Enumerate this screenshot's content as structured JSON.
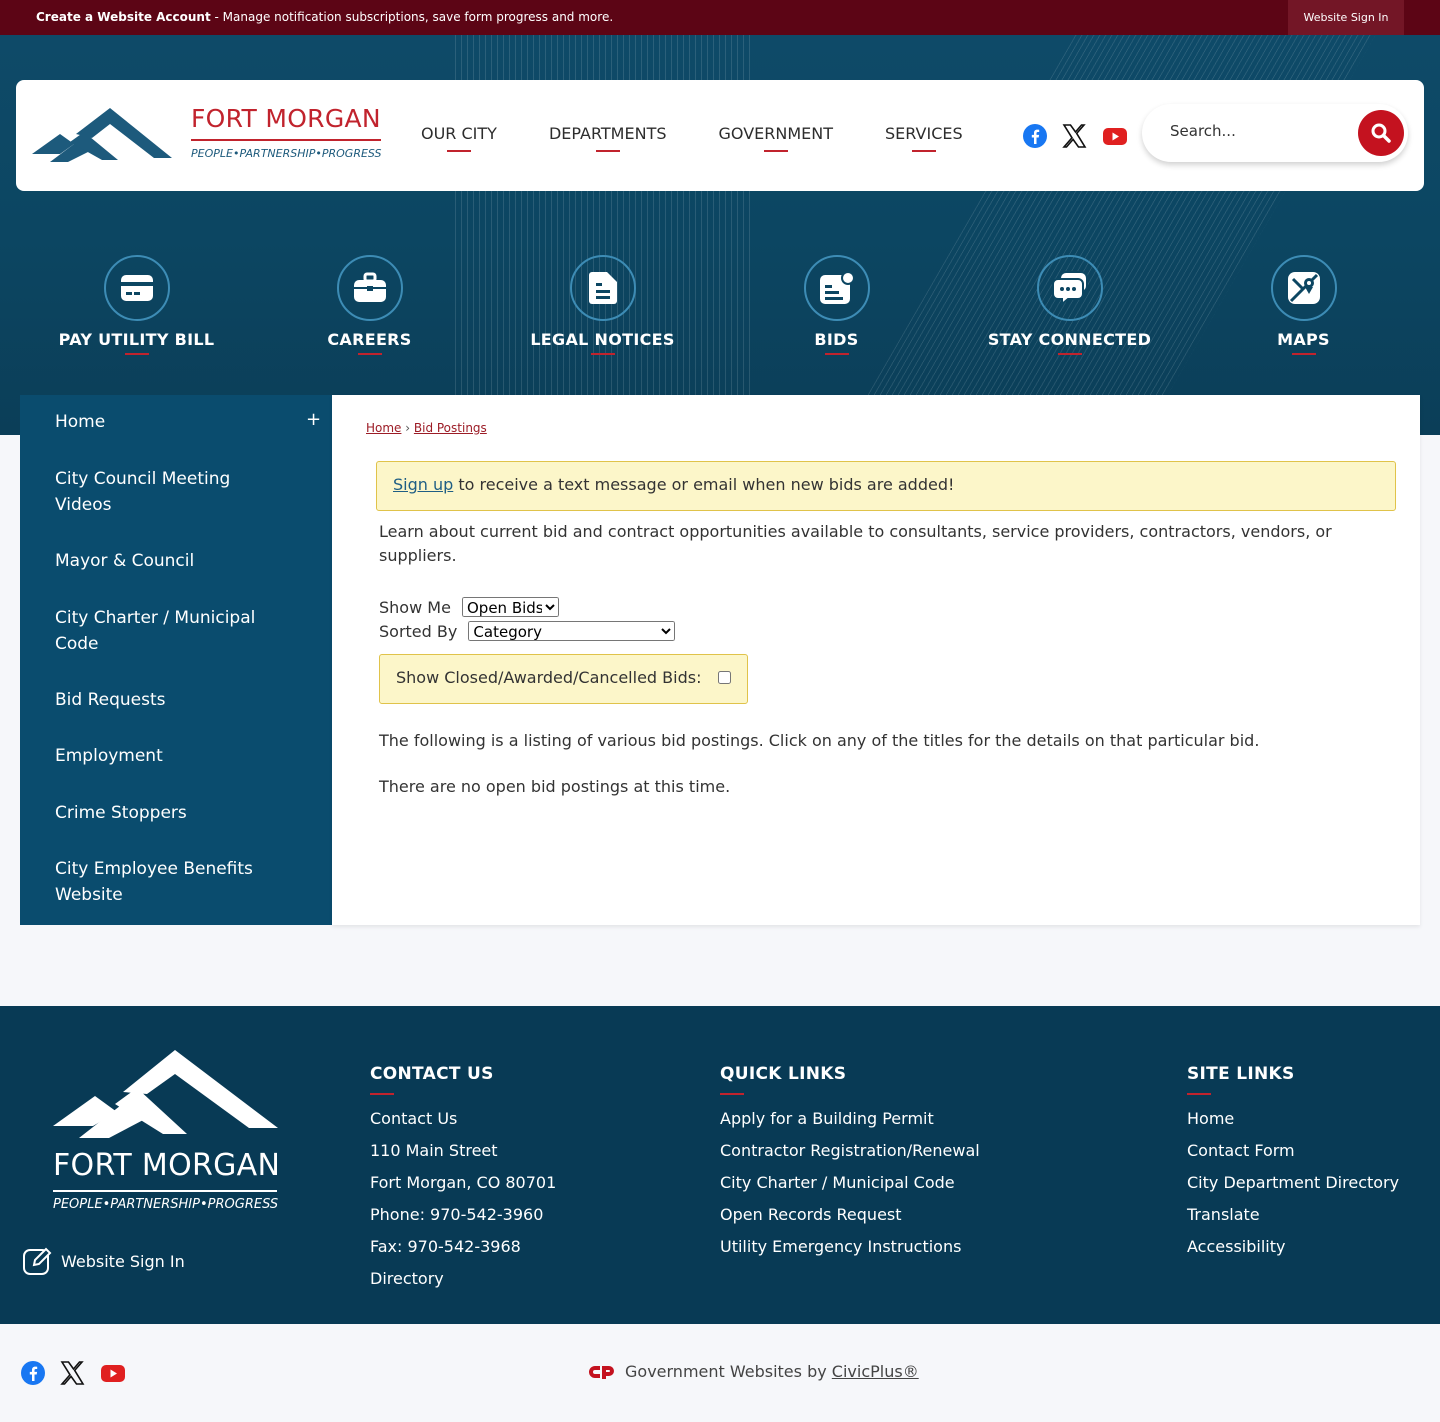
{
  "topbar": {
    "create_account": "Create a Website Account",
    "message": " - Manage notification subscriptions, save form progress and more.",
    "signin": "Website Sign In"
  },
  "brand": {
    "title": "FORT MORGAN",
    "tagline": "PEOPLE•PARTNERSHIP•PROGRESS"
  },
  "nav": [
    "OUR CITY",
    "DEPARTMENTS",
    "GOVERNMENT",
    "SERVICES"
  ],
  "search": {
    "placeholder": "Search..."
  },
  "quick_links": [
    {
      "label": "PAY UTILITY BILL",
      "icon": "credit-card-icon"
    },
    {
      "label": "CAREERS",
      "icon": "briefcase-icon"
    },
    {
      "label": "LEGAL NOTICES",
      "icon": "document-icon"
    },
    {
      "label": "BIDS",
      "icon": "bids-document-icon"
    },
    {
      "label": "STAY CONNECTED",
      "icon": "chat-bubbles-icon"
    },
    {
      "label": "MAPS",
      "icon": "map-icon"
    }
  ],
  "sidebar": {
    "items": [
      "Home",
      "City Council Meeting Videos",
      "Mayor & Council",
      "City Charter / Municipal Code",
      "Bid Requests",
      "Employment",
      "Crime Stoppers",
      "City Employee Benefits Website"
    ],
    "expand": "+"
  },
  "content": {
    "breadcrumb": {
      "home": "Home",
      "sep": " › ",
      "current": "Bid Postings"
    },
    "alert": {
      "link": "Sign up",
      "text": " to receive a text message or email when new bids are added!"
    },
    "intro": "Learn about current bid and contract opportunities available to consultants, service providers, contractors, vendors, or suppliers.",
    "show_me_label": "Show Me",
    "show_me_value": "Open Bids",
    "sorted_by_label": "Sorted By",
    "sorted_by_value": "Category",
    "closed_label": "Show Closed/Awarded/Cancelled Bids:",
    "listing_text": "The following is a listing of various bid postings. Click on any of the titles for the details on that particular bid.",
    "empty_text": "There are no open bid postings at this time."
  },
  "footer": {
    "logo_title": "FORT MORGAN",
    "logo_tagline": "PEOPLE•PARTNERSHIP•PROGRESS",
    "signin": "Website Sign In",
    "contact": {
      "title": "CONTACT US",
      "lines": [
        "Contact Us",
        "110 Main Street",
        "Fort Morgan, CO 80701",
        "Phone: 970-542-3960",
        "Fax: 970-542-3968",
        "Directory"
      ]
    },
    "quick": {
      "title": "QUICK LINKS",
      "lines": [
        "Apply for a Building Permit",
        "Contractor Registration/Renewal",
        "City Charter / Municipal Code",
        "Open Records Request",
        "Utility Emergency Instructions"
      ]
    },
    "site": {
      "title": "SITE LINKS",
      "lines": [
        "Home",
        "Contact Form",
        "City Department Directory",
        "Translate",
        "Accessibility"
      ]
    }
  },
  "bottom": {
    "credit_prefix": "Government Websites by ",
    "credit_link": "CivicPlus®"
  },
  "colors": {
    "brand_red": "#c1232d",
    "navy": "#0a4c6e",
    "footer": "#083a55",
    "topbar": "#5c0515"
  }
}
